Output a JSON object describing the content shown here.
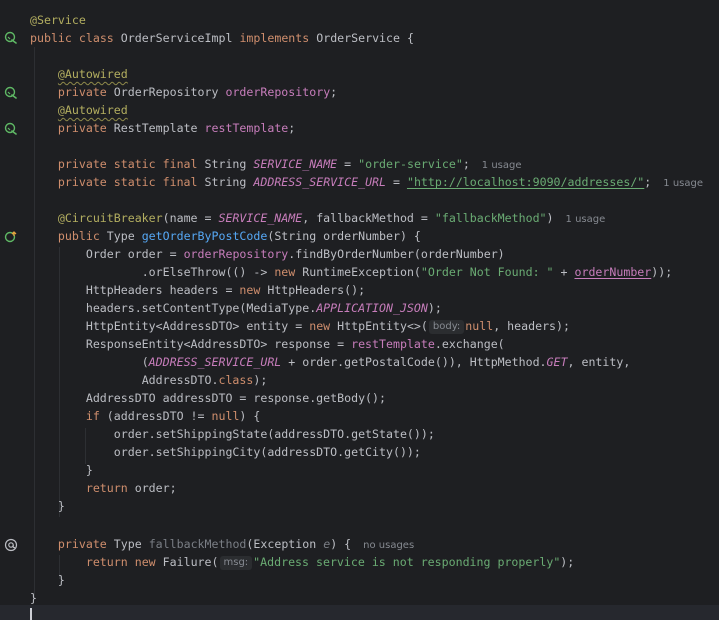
{
  "editor": {
    "code": {
      "service_annotation": "@Service",
      "class_kw_public": "public",
      "class_kw_class": "class",
      "class_name": "OrderServiceImpl",
      "implements_kw": "implements",
      "interface_name": "OrderService",
      "open_brace": "{",
      "autowired_1": "@Autowired",
      "repo_decl_kw": "private",
      "repo_type": "OrderRepository",
      "repo_field": "orderRepository",
      "autowired_2": "@Autowired",
      "rest_decl_kw": "private",
      "rest_type": "RestTemplate",
      "rest_field": "restTemplate",
      "service_name_mods": "private static final",
      "service_name_type": "String",
      "service_name_const": "SERVICE_NAME",
      "service_name_value": "\"order-service\"",
      "service_name_usage": "1 usage",
      "address_url_mods": "private static final",
      "address_url_type": "String",
      "address_url_const": "ADDRESS_SERVICE_URL",
      "address_url_value": "\"http://localhost:9090/addresses/\"",
      "address_url_usage": "1 usage",
      "circuit_breaker": "@CircuitBreaker",
      "cb_name_param": "(name = ",
      "cb_name_value": "SERVICE_NAME",
      "cb_fallback_param": ", fallbackMethod = ",
      "cb_fallback_value": "\"fallbackMethod\"",
      "cb_close": ")",
      "cb_usage": "1 usage",
      "method_public": "public",
      "method_type": "Type",
      "method_name": "getOrderByPostCode",
      "method_params": "(String orderNumber) {",
      "order_decl": "Order order = ",
      "order_repo_ref": "orderRepository",
      "order_find": ".findByOrderNumber(orderNumber)",
      "or_else_throw": ".orElseThrow(() -> ",
      "or_else_new": "new",
      "or_else_exc": " RuntimeException(",
      "or_else_msg": "\"Order Not Found: \"",
      "or_else_plus": " + ",
      "or_else_param": "orderNumber",
      "or_else_close": "));",
      "headers_decl": "HttpHeaders headers = ",
      "headers_new": "new",
      "headers_ctor": " HttpHeaders();",
      "headers_set": "headers.setContentType(MediaType.",
      "headers_media": "APPLICATION_JSON",
      "headers_set_close": ");",
      "entity_decl": "HttpEntity<AddressDTO> entity = ",
      "entity_new": "new",
      "entity_ctor": " HttpEntity<>(",
      "entity_hint": "body:",
      "entity_null": "null",
      "entity_rest": ", headers);",
      "response_decl": "ResponseEntity<AddressDTO> response = ",
      "response_rest": "restTemplate",
      "response_exchange": ".exchange(",
      "response_open": "(",
      "response_url": "ADDRESS_SERVICE_URL",
      "response_postal": " + order.getPostalCode()), HttpMethod.",
      "response_get": "GET",
      "response_entity": ", entity,",
      "response_class": "AddressDTO.",
      "response_class_kw": "class",
      "response_close": ");",
      "body_decl": "AddressDTO addressDTO = response.getBody();",
      "if_kw": "if",
      "if_cond": " (addressDTO != ",
      "if_null": "null",
      "if_close": ") {",
      "set_state": "order.setShippingState(addressDTO.getState());",
      "set_city": "order.setShippingCity(addressDTO.getCity());",
      "if_end": "}",
      "return_kw": "return",
      "return_val": " order;",
      "method_end": "}",
      "fb_private": "private",
      "fb_type": "Type",
      "fb_name": "fallbackMethod",
      "fb_paren": "(Exception ",
      "fb_param": "e",
      "fb_close": ") {",
      "fb_usage": "no usages",
      "fb_return": "return",
      "fb_new": "new",
      "fb_failure": " Failure(",
      "fb_hint": "msg:",
      "fb_msg": "\"Address service is not responding properly\"",
      "fb_msg_close": ");",
      "fb_end": "}",
      "class_end": "}"
    },
    "gutter_icons": {
      "class_impl": "implemented-bean-icon",
      "repo_bean": "bean-navigation-icon",
      "rest_bean": "bean-navigation-icon",
      "method_override": "override-method-icon",
      "fallback_at": "at-sign-icon"
    }
  }
}
